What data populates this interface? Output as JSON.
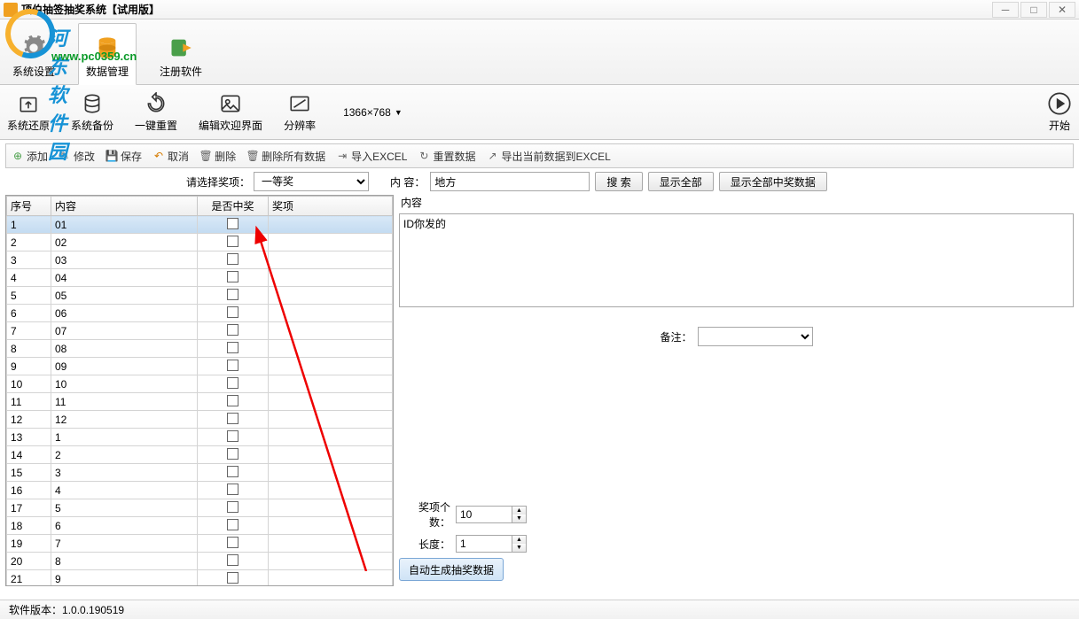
{
  "window": {
    "title": "顶伯抽签抽奖系统【试用版】"
  },
  "watermark": {
    "name": "河东软件园",
    "url": "www.pc0359.cn"
  },
  "maintabs": [
    {
      "label": "系统设置"
    },
    {
      "label": "数据管理"
    },
    {
      "label": "注册软件"
    }
  ],
  "toolbar": {
    "restore": "系统还原",
    "backup": "系统备份",
    "reset": "一键重置",
    "edit_welcome": "编辑欢迎界面",
    "resolution": "分辨率",
    "resolution_value": "1366×768",
    "start": "开始"
  },
  "actions": {
    "add": "添加",
    "modify": "修改",
    "save": "保存",
    "cancel": "取消",
    "delete": "删除",
    "delete_all": "删除所有数据",
    "import_excel": "导入EXCEL",
    "reset_data": "重置数据",
    "export_excel": "导出当前数据到EXCEL"
  },
  "filter": {
    "prize_label": "请选择奖项：",
    "prize_value": "一等奖",
    "content_label": "内 容：",
    "content_value": "地方",
    "search": "搜  索",
    "show_all": "显示全部",
    "show_all_win": "显示全部中奖数据"
  },
  "table": {
    "headers": {
      "seq": "序号",
      "content": "内容",
      "win": "是否中奖",
      "prize": "奖项"
    },
    "rows": [
      {
        "seq": "1",
        "content": "01",
        "win": false,
        "selected": true
      },
      {
        "seq": "2",
        "content": "02",
        "win": false
      },
      {
        "seq": "3",
        "content": "03",
        "win": false
      },
      {
        "seq": "4",
        "content": "04",
        "win": false
      },
      {
        "seq": "5",
        "content": "05",
        "win": false
      },
      {
        "seq": "6",
        "content": "06",
        "win": false
      },
      {
        "seq": "7",
        "content": "07",
        "win": false
      },
      {
        "seq": "8",
        "content": "08",
        "win": false
      },
      {
        "seq": "9",
        "content": "09",
        "win": false
      },
      {
        "seq": "10",
        "content": "10",
        "win": false
      },
      {
        "seq": "11",
        "content": "11",
        "win": false
      },
      {
        "seq": "12",
        "content": "12",
        "win": false
      },
      {
        "seq": "13",
        "content": "1",
        "win": false
      },
      {
        "seq": "14",
        "content": "2",
        "win": false
      },
      {
        "seq": "15",
        "content": "3",
        "win": false
      },
      {
        "seq": "16",
        "content": "4",
        "win": false
      },
      {
        "seq": "17",
        "content": "5",
        "win": false
      },
      {
        "seq": "18",
        "content": "6",
        "win": false
      },
      {
        "seq": "19",
        "content": "7",
        "win": false
      },
      {
        "seq": "20",
        "content": "8",
        "win": false
      },
      {
        "seq": "21",
        "content": "9",
        "win": false
      }
    ]
  },
  "right": {
    "content_title": "内容",
    "content_text": "ID你发的",
    "remark_label": "备注：",
    "prize_count_label": "奖项个数：",
    "prize_count_value": "10",
    "length_label": "长度：",
    "length_value": "1",
    "auto_gen": "自动生成抽奖数据"
  },
  "status": {
    "version_label": "软件版本：",
    "version": "1.0.0.190519"
  }
}
